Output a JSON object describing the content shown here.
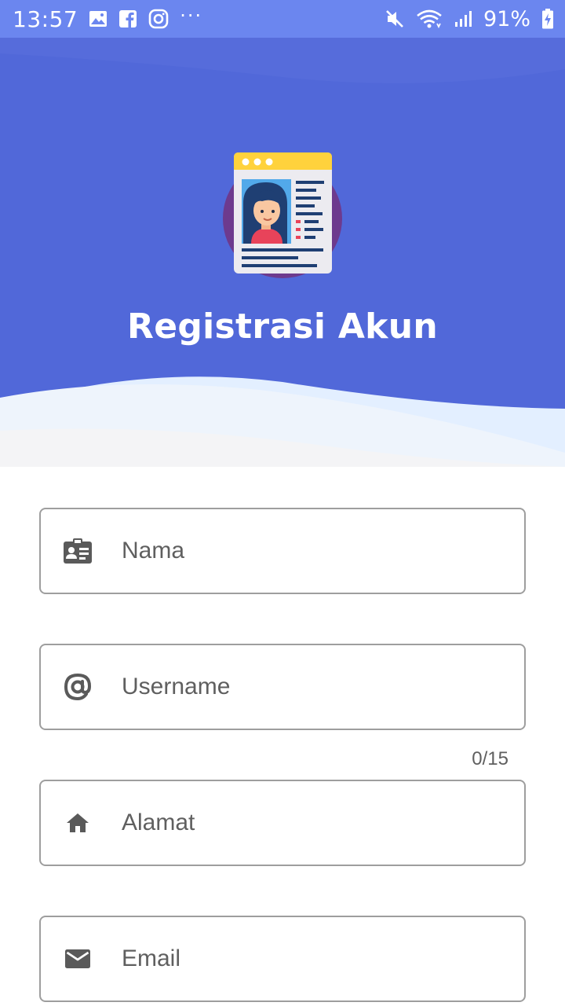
{
  "status_bar": {
    "time": "13:57",
    "battery": "91%",
    "more": "···",
    "left_icons": [
      "gallery-icon",
      "facebook-icon",
      "instagram-icon"
    ],
    "right_icons": [
      "mute-icon",
      "wifi-icon",
      "signal-icon",
      "battery-charging-icon"
    ],
    "background": "#6b86ef"
  },
  "header": {
    "title": "Registrasi Akun",
    "background": "#5168d9",
    "illustration": "id-card-profile-illustration"
  },
  "form": {
    "fields": [
      {
        "icon": "id-card-icon",
        "placeholder": "Nama"
      },
      {
        "icon": "at-sign-icon",
        "placeholder": "Username",
        "counter": "0/15"
      },
      {
        "icon": "home-icon",
        "placeholder": "Alamat"
      },
      {
        "icon": "email-icon",
        "placeholder": "Email"
      }
    ],
    "border_color": "#9e9e9e"
  }
}
